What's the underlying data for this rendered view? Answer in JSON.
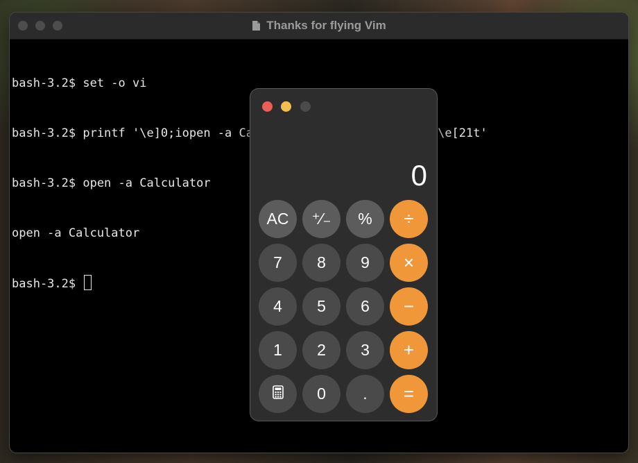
{
  "terminal": {
    "title": "Thanks for flying Vim",
    "lines": [
      "bash-3.2$ set -o vi",
      "bash-3.2$ printf '\\e]0;iopen -a Calculator\\a\\e[21t\\e]0;vZZ\\a\\e[21t'",
      "bash-3.2$ open -a Calculator",
      "open -a Calculator"
    ],
    "prompt": "bash-3.2$ "
  },
  "calculator": {
    "display": "0",
    "keys": [
      {
        "label": "AC",
        "kind": "function"
      },
      {
        "label": "⁺∕₋",
        "kind": "function"
      },
      {
        "label": "%",
        "kind": "function"
      },
      {
        "label": "÷",
        "kind": "operator"
      },
      {
        "label": "7",
        "kind": "digit"
      },
      {
        "label": "8",
        "kind": "digit"
      },
      {
        "label": "9",
        "kind": "digit"
      },
      {
        "label": "×",
        "kind": "operator"
      },
      {
        "label": "4",
        "kind": "digit"
      },
      {
        "label": "5",
        "kind": "digit"
      },
      {
        "label": "6",
        "kind": "digit"
      },
      {
        "label": "−",
        "kind": "operator"
      },
      {
        "label": "1",
        "kind": "digit"
      },
      {
        "label": "2",
        "kind": "digit"
      },
      {
        "label": "3",
        "kind": "digit"
      },
      {
        "label": "+",
        "kind": "operator"
      },
      {
        "label": "",
        "kind": "icon",
        "icon": "calculator-icon"
      },
      {
        "label": "0",
        "kind": "digit"
      },
      {
        "label": ".",
        "kind": "digit"
      },
      {
        "label": "=",
        "kind": "operator"
      }
    ]
  },
  "colors": {
    "operator": "#f0973a",
    "close": "#ec5f57",
    "minimize": "#f2bf4f"
  }
}
